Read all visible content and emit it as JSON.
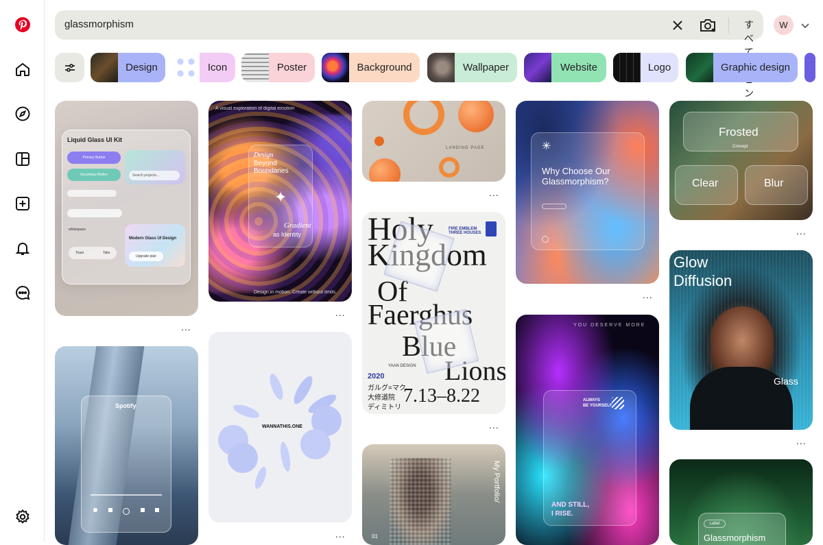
{
  "search": {
    "query": "glassmorphism",
    "filter_label": "すべてのピン"
  },
  "account": {
    "initial": "W"
  },
  "chips": [
    "Design",
    "Icon",
    "Poster",
    "Background",
    "Wallpaper",
    "Website",
    "Logo",
    "Graphic design"
  ],
  "pins": {
    "liquid_glass": {
      "title": "Liquid Glass UI Kit",
      "primary": "Primary Button",
      "secondary": "Secondary Button",
      "search": "Search projects...",
      "modern": "Modern Glass UI Design",
      "upgrade": "Upgrade plan",
      "toast": "Toast",
      "tabs": "Tabs",
      "whitespace": "whitespace"
    },
    "swirl": {
      "top": "A visual exploration of digital emotion",
      "line1": "Design",
      "line2": "Beyond",
      "line3": "Boundaries",
      "script": "Gradient",
      "line4": "as Identity",
      "bottom": "Design in motion. Create without limits."
    },
    "orange_landing": {
      "label": "LANDING PAGE"
    },
    "why_glass": {
      "line1": "Why Choose Our",
      "line2": "Glassmorphism?"
    },
    "frosted": {
      "title": "Frosted",
      "sub": "Concept",
      "left": "Clear",
      "right": "Blur"
    },
    "holy_kingdom": {
      "l1": "Holy",
      "l2": "Kingdom",
      "l3": "Of",
      "l4": "Faerghus",
      "l5": "Blue",
      "l6": "Lions",
      "header": "FIRE EMBLEM THREE HOUSES",
      "year": "2020",
      "jp1": "ガルグ=マク",
      "jp2": "大修道院",
      "jp3": "ディミトリ",
      "dates": "7.13–8.22",
      "design": "YAAN DESIGN"
    },
    "glow_diffusion": {
      "line1": "Glow",
      "line2": "Diffusion",
      "glass": "Glass"
    },
    "spotify": {
      "title": "Spotify"
    },
    "wannathis": {
      "label": "WANNATHIS.ONE"
    },
    "always": {
      "top": "YOU DESERVE MORE",
      "badge1": "ALWAYS",
      "badge2": "BE YOURSELF",
      "quote1": "AND STILL,",
      "quote2": "I RISE."
    },
    "portfolio": {
      "label": "My Portfolio/",
      "num": "01"
    },
    "glass_green": {
      "label": "Label",
      "title": "Glassmorphism"
    }
  },
  "more_label": "..."
}
